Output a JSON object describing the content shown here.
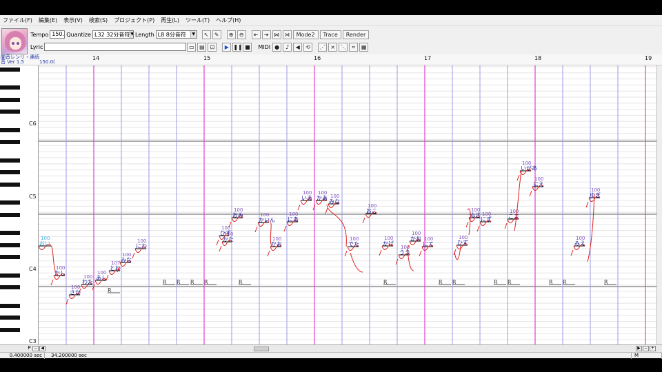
{
  "menu": [
    "ファイル(F)",
    "編集(E)",
    "表示(V)",
    "検索(S)",
    "プロジェクト(P)",
    "再生(L)",
    "ツール(T)",
    "ヘルプ(H)"
  ],
  "toolbar": {
    "tempo_label": "Tempo",
    "tempo_value": "150.0",
    "quantize_label": "Quantize",
    "quantize_value": "L32 32分音符",
    "length_label": "Length",
    "length_value": "L8 8分音符",
    "mode2_label": "Mode2",
    "trace_label": "Trace",
    "render_label": "Render",
    "lyric_label": "Lyric",
    "lyric_value": "",
    "midi_label": "MIDI"
  },
  "track": {
    "name": "闇音レンリ・連続",
    "version": "音 Ver 1.5",
    "tempo": "150.0("
  },
  "bars": [
    "14",
    "15",
    "16",
    "17",
    "18",
    "19"
  ],
  "octaves": [
    "C6",
    "C5",
    "C4",
    "C3"
  ],
  "status": {
    "time_start": "0.400000 sec",
    "time_end": "34.200000 sec",
    "mode": "M"
  },
  "scrollbar": {
    "p_label": "P"
  },
  "notes": [
    {
      "lyric": "おい",
      "vel": "100"
    },
    {
      "lyric": "かし",
      "vel": "100"
    },
    {
      "lyric": "さか",
      "vel": "100"
    },
    {
      "lyric": "わた",
      "vel": "100"
    },
    {
      "lyric": "あし",
      "vel": "100"
    },
    {
      "lyric": "とわ",
      "vel": "107"
    },
    {
      "lyric": "みな",
      "vel": "100"
    },
    {
      "lyric": "にわ",
      "vel": "100"
    },
    {
      "lyric": "ひず",
      "vel": "100"
    },
    {
      "lyric": "かた",
      "vel": "100"
    },
    {
      "lyric": "おみ",
      "vel": "100"
    },
    {
      "lyric": "かいん",
      "vel": "100"
    },
    {
      "lyric": "かお",
      "vel": "100"
    },
    {
      "lyric": "にあ",
      "vel": "100"
    },
    {
      "lyric": "いあ",
      "vel": "100"
    },
    {
      "lyric": "かあ",
      "vel": "100"
    },
    {
      "lyric": "みな",
      "vel": "100"
    },
    {
      "lyric": "でた",
      "vel": "100"
    },
    {
      "lyric": "おこ",
      "vel": "100"
    },
    {
      "lyric": "かげ",
      "vel": "100"
    },
    {
      "lyric": "うう",
      "vel": "100"
    },
    {
      "lyric": "かお",
      "vel": "100"
    },
    {
      "lyric": "にて",
      "vel": "100"
    },
    {
      "lyric": "ひず",
      "vel": "100"
    },
    {
      "lyric": "ぬさ",
      "vel": "100"
    },
    {
      "lyric": "にず",
      "vel": "100"
    },
    {
      "lyric": "こま",
      "vel": "100"
    },
    {
      "lyric": "いがあ",
      "vel": "100"
    },
    {
      "lyric": "にえ",
      "vel": "100"
    },
    {
      "lyric": "みえ",
      "vel": "100"
    },
    {
      "lyric": "ゆぎ",
      "vel": "100"
    }
  ],
  "rests": [
    "R",
    "R",
    "R",
    "R",
    "R",
    "R",
    "R",
    "R",
    "R",
    "R",
    "R",
    "R",
    "R",
    "R"
  ],
  "colors": {
    "bar_line": "#e040d0",
    "beat_line": "#9a9ae8",
    "note_curve": "#e02020",
    "note_label": "#2020a0",
    "vel_label": "#8050c0",
    "first_note": "#4ab0e0"
  }
}
